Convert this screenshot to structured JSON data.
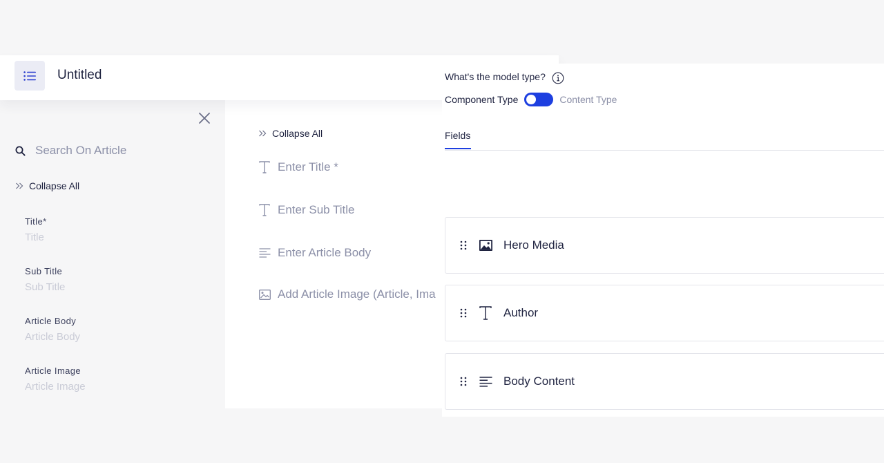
{
  "header": {
    "title": "Untitled",
    "menu_icon": "list-icon"
  },
  "sidebar": {
    "search_placeholder": "Search On Article",
    "collapse_label": "Collapse All",
    "fields": [
      {
        "label": "Title*",
        "value": "Title"
      },
      {
        "label": "Sub Title",
        "value": "Sub Title"
      },
      {
        "label": "Article Body",
        "value": "Article Body"
      },
      {
        "label": "Article Image",
        "value": "Article Image"
      }
    ]
  },
  "editor": {
    "collapse_label": "Collapse All",
    "rows": [
      {
        "icon": "text-icon",
        "placeholder": "Enter Title *"
      },
      {
        "icon": "text-icon",
        "placeholder": "Enter Sub Title"
      },
      {
        "icon": "paragraph-icon",
        "placeholder": "Enter Article Body"
      },
      {
        "icon": "image-icon",
        "placeholder": "Add Article Image (Article, Ima"
      }
    ]
  },
  "panel": {
    "question": "What's the model type?",
    "type_left": "Component Type",
    "type_right": "Content Type",
    "tab_fields": "Fields",
    "fields": [
      {
        "name": "Hero Media",
        "icon": "image-icon"
      },
      {
        "name": "Author",
        "icon": "text-icon"
      },
      {
        "name": "Body Content",
        "icon": "paragraph-icon"
      }
    ]
  },
  "colors": {
    "accent": "#1d3fe0",
    "text": "#1f2340",
    "muted": "#8c90a8",
    "faint": "#c9cbd6",
    "border": "#e3e4ea"
  }
}
